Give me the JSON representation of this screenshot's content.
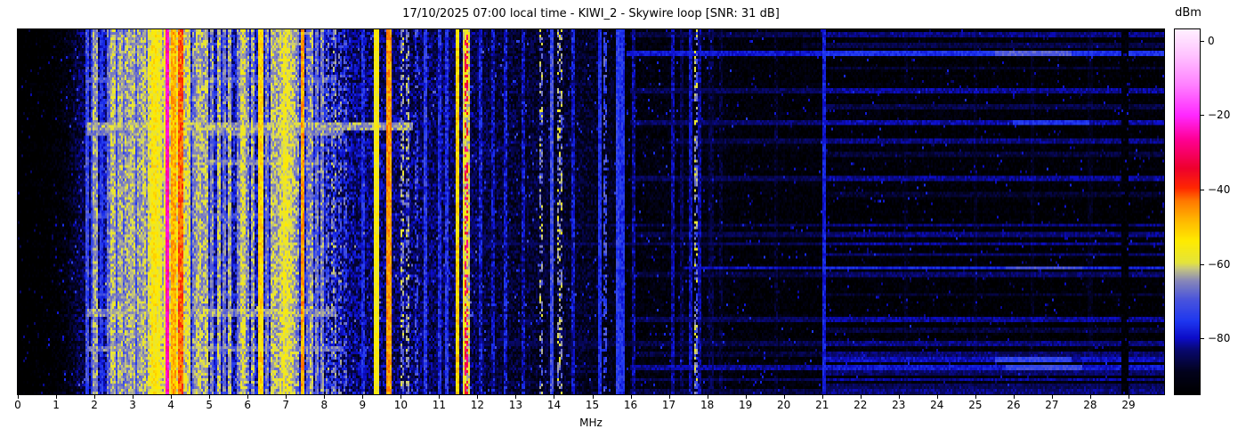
{
  "header": {
    "datetime_local": "17/10/2025 07:00",
    "station": "KIWI_2",
    "antenna": "Skywire loop",
    "snr": "31 dB"
  },
  "chart_data": {
    "type": "heatmap",
    "title": "17/10/2025 07:00 local time - KIWI_2 - Skywire loop [SNR: 31 dB]",
    "xlabel": "MHz",
    "colorbar_label": "dBm",
    "x_range": [
      0,
      29.93
    ],
    "xticks": [
      0,
      1,
      2,
      3,
      4,
      5,
      6,
      7,
      8,
      9,
      10,
      11,
      12,
      13,
      14,
      15,
      16,
      17,
      18,
      19,
      20,
      21,
      22,
      23,
      24,
      25,
      26,
      27,
      28,
      29
    ],
    "z_range": [
      -95,
      3
    ],
    "colorbar_ticks": [
      {
        "v": 0,
        "label": "0"
      },
      {
        "v": -20,
        "label": "−20"
      },
      {
        "v": -40,
        "label": "−40"
      },
      {
        "v": -60,
        "label": "−60"
      },
      {
        "v": -80,
        "label": "−80"
      }
    ],
    "colormap_stops": [
      [
        0.0,
        0,
        0,
        0
      ],
      [
        0.06,
        2,
        2,
        28
      ],
      [
        0.12,
        8,
        8,
        110
      ],
      [
        0.153,
        12,
        12,
        200
      ],
      [
        0.2,
        30,
        55,
        240
      ],
      [
        0.26,
        75,
        85,
        220
      ],
      [
        0.31,
        135,
        135,
        185
      ],
      [
        0.345,
        200,
        200,
        125
      ],
      [
        0.36,
        228,
        228,
        60
      ],
      [
        0.42,
        255,
        235,
        0
      ],
      [
        0.48,
        255,
        180,
        0
      ],
      [
        0.53,
        255,
        120,
        0
      ],
      [
        0.565,
        255,
        40,
        0
      ],
      [
        0.62,
        238,
        0,
        45
      ],
      [
        0.7,
        255,
        0,
        150
      ],
      [
        0.765,
        255,
        40,
        255
      ],
      [
        0.85,
        255,
        130,
        255
      ],
      [
        0.93,
        255,
        195,
        255
      ],
      [
        1.0,
        255,
        240,
        255
      ]
    ],
    "background_profile_mhz_dbm": [
      [
        0,
        -97
      ],
      [
        0.8,
        -96
      ],
      [
        1.3,
        -92
      ],
      [
        1.6,
        -86
      ],
      [
        2.0,
        -84
      ],
      [
        2.3,
        -80
      ],
      [
        2.6,
        -78
      ],
      [
        3.0,
        -79
      ],
      [
        3.4,
        -77
      ],
      [
        3.8,
        -76
      ],
      [
        4.3,
        -77
      ],
      [
        4.8,
        -79
      ],
      [
        5.5,
        -80
      ],
      [
        6.5,
        -79
      ],
      [
        7.3,
        -78
      ],
      [
        7.9,
        -80
      ],
      [
        8.4,
        -82
      ],
      [
        9.0,
        -84
      ],
      [
        10.0,
        -84
      ],
      [
        10.8,
        -85
      ],
      [
        11.8,
        -85
      ],
      [
        12.3,
        -87
      ],
      [
        13.0,
        -88
      ],
      [
        14.0,
        -88
      ],
      [
        15.0,
        -89
      ],
      [
        15.5,
        -90
      ],
      [
        15.9,
        -93
      ],
      [
        16.6,
        -92
      ],
      [
        18.0,
        -91.5
      ],
      [
        19.0,
        -93
      ],
      [
        21.0,
        -93.5
      ],
      [
        25.0,
        -94
      ],
      [
        29.93,
        -94.5
      ]
    ],
    "speckle_profile_mhz_db": [
      [
        0,
        3
      ],
      [
        1.5,
        5
      ],
      [
        2.3,
        7
      ],
      [
        8,
        7
      ],
      [
        9,
        6
      ],
      [
        13,
        5
      ],
      [
        16,
        4
      ],
      [
        21,
        3.5
      ],
      [
        29.93,
        3.5
      ]
    ],
    "signals_mhz_w_dbm_jit_dash": [
      [
        1.83,
        0.05,
        -72,
        6,
        0
      ],
      [
        1.95,
        0.05,
        -74,
        6,
        0
      ],
      [
        2.02,
        0.05,
        -64,
        5,
        0
      ],
      [
        2.2,
        0.05,
        -76,
        5,
        0
      ],
      [
        2.37,
        0.05,
        -68,
        6,
        0
      ],
      [
        2.49,
        0.09,
        -62,
        5,
        0
      ],
      [
        2.57,
        0.05,
        -71,
        6,
        0
      ],
      [
        2.67,
        0.09,
        -63,
        5,
        0
      ],
      [
        2.76,
        0.05,
        -68,
        6,
        0
      ],
      [
        2.84,
        0.09,
        -64,
        6,
        0
      ],
      [
        2.92,
        0.05,
        -67,
        6,
        0
      ],
      [
        3.0,
        0.09,
        -63,
        5,
        0
      ],
      [
        3.09,
        0.05,
        -70,
        6,
        0
      ],
      [
        3.2,
        0.09,
        -64,
        5,
        0
      ],
      [
        3.3,
        0.09,
        -62,
        5,
        0
      ],
      [
        3.38,
        0.05,
        -67,
        6,
        0
      ],
      [
        3.48,
        0.09,
        -59,
        5,
        0
      ],
      [
        3.56,
        0.09,
        -55,
        5,
        0
      ],
      [
        3.63,
        0.09,
        -57,
        5,
        0
      ],
      [
        3.7,
        0.09,
        -60,
        5,
        0
      ],
      [
        3.78,
        0.05,
        -62,
        5,
        0
      ],
      [
        3.85,
        0.05,
        -58,
        5,
        0
      ],
      [
        3.91,
        0.05,
        -24,
        3,
        0
      ],
      [
        3.98,
        0.05,
        -60,
        5,
        0
      ],
      [
        4.07,
        0.07,
        -48,
        5,
        0
      ],
      [
        4.17,
        0.05,
        -58,
        5,
        0
      ],
      [
        4.26,
        0.09,
        -42,
        4,
        0
      ],
      [
        4.36,
        0.05,
        -60,
        6,
        0
      ],
      [
        4.47,
        0.07,
        -60,
        5,
        0
      ],
      [
        4.6,
        0.05,
        -66,
        6,
        0
      ],
      [
        4.72,
        0.07,
        -62,
        5,
        0
      ],
      [
        4.85,
        0.05,
        -64,
        6,
        0
      ],
      [
        4.93,
        0.05,
        -62,
        5,
        0
      ],
      [
        5.05,
        0.05,
        -66,
        6,
        0
      ],
      [
        5.26,
        0.06,
        -62,
        5,
        0
      ],
      [
        5.4,
        0.05,
        -68,
        6,
        0
      ],
      [
        5.53,
        0.06,
        -63,
        5,
        0
      ],
      [
        5.75,
        0.05,
        -67,
        6,
        0
      ],
      [
        5.88,
        0.07,
        -60,
        5,
        0
      ],
      [
        6.0,
        0.05,
        -66,
        6,
        0
      ],
      [
        6.15,
        0.05,
        -64,
        6,
        0
      ],
      [
        6.35,
        0.1,
        -52,
        5,
        0
      ],
      [
        6.5,
        0.05,
        -67,
        6,
        0
      ],
      [
        6.67,
        0.07,
        -62,
        5,
        0
      ],
      [
        6.8,
        0.06,
        -63,
        5,
        0
      ],
      [
        6.9,
        0.06,
        -60,
        5,
        0
      ],
      [
        7.0,
        0.08,
        -58,
        5,
        0
      ],
      [
        7.1,
        0.06,
        -60,
        5,
        0
      ],
      [
        7.2,
        0.06,
        -62,
        5,
        0
      ],
      [
        7.3,
        0.05,
        -65,
        6,
        0
      ],
      [
        7.44,
        0.05,
        -47,
        5,
        0
      ],
      [
        7.56,
        0.05,
        -67,
        6,
        0
      ],
      [
        7.67,
        0.05,
        -64,
        6,
        0
      ],
      [
        7.8,
        0.05,
        -68,
        6,
        0
      ],
      [
        7.95,
        0.05,
        -66,
        6,
        0
      ],
      [
        8.1,
        0.05,
        -69,
        7,
        1
      ],
      [
        8.25,
        0.05,
        -67,
        7,
        1
      ],
      [
        8.4,
        0.05,
        -69,
        7,
        1
      ],
      [
        8.55,
        0.05,
        -71,
        7,
        1
      ],
      [
        9.0,
        0.05,
        -77,
        6,
        0
      ],
      [
        9.37,
        0.08,
        -56,
        4,
        0
      ],
      [
        9.7,
        0.08,
        -46,
        4,
        0
      ],
      [
        10.05,
        0.05,
        -64,
        6,
        1
      ],
      [
        10.16,
        0.05,
        -65,
        6,
        1
      ],
      [
        10.42,
        0.05,
        -73,
        6,
        1
      ],
      [
        10.65,
        0.05,
        -75,
        6,
        0
      ],
      [
        11.0,
        0.05,
        -77,
        6,
        0
      ],
      [
        11.2,
        0.05,
        -76,
        6,
        0
      ],
      [
        11.47,
        0.06,
        -52,
        5,
        0
      ],
      [
        11.66,
        0.05,
        -58,
        5,
        0
      ],
      [
        11.71,
        0.04,
        -32,
        6,
        1
      ],
      [
        11.76,
        0.05,
        -60,
        5,
        0
      ],
      [
        12.1,
        0.05,
        -79,
        6,
        0
      ],
      [
        12.4,
        0.05,
        -81,
        6,
        0
      ],
      [
        12.75,
        0.05,
        -79,
        6,
        0
      ],
      [
        13.2,
        0.05,
        -81,
        6,
        0
      ],
      [
        13.65,
        0.05,
        -66,
        8,
        1
      ],
      [
        13.95,
        0.05,
        -72,
        6,
        0
      ],
      [
        14.15,
        0.05,
        -64,
        8,
        1
      ],
      [
        14.5,
        0.05,
        -80,
        5,
        0
      ],
      [
        15.2,
        0.06,
        -76,
        4,
        0
      ],
      [
        15.35,
        0.05,
        -72,
        6,
        1
      ],
      [
        15.65,
        0.06,
        -74,
        4,
        0
      ],
      [
        15.78,
        0.05,
        -76,
        4,
        0
      ],
      [
        16.1,
        0.05,
        -82,
        5,
        0
      ],
      [
        17.1,
        0.05,
        -82,
        4,
        0
      ],
      [
        17.35,
        0.05,
        -86,
        4,
        0
      ],
      [
        17.55,
        0.05,
        -80,
        4,
        0
      ],
      [
        17.7,
        0.04,
        -66,
        9,
        1
      ],
      [
        17.78,
        0.05,
        -82,
        4,
        0
      ],
      [
        18.1,
        0.09,
        -87,
        4,
        0
      ],
      [
        18.35,
        0.05,
        -88,
        4,
        0
      ],
      [
        19.8,
        0.05,
        -89,
        4,
        0
      ],
      [
        21.05,
        0.06,
        -78,
        3,
        0
      ],
      [
        23.2,
        0.05,
        -90,
        3,
        0
      ],
      [
        25.0,
        0.05,
        -90,
        3,
        0
      ],
      [
        26.5,
        0.05,
        -90,
        3,
        0
      ],
      [
        28.0,
        0.05,
        -90,
        3,
        0
      ]
    ],
    "noise_bands_y_h_f0_f1_dbm": [
      [
        55,
        4,
        1.8,
        8.3,
        -71
      ],
      [
        107,
        6,
        1.8,
        10.3,
        -64
      ],
      [
        115,
        4,
        1.8,
        8.5,
        -67
      ],
      [
        148,
        5,
        4.8,
        8.0,
        -67
      ],
      [
        209,
        3,
        1.8,
        7.0,
        -73
      ],
      [
        297,
        3,
        2.0,
        8.0,
        -73
      ],
      [
        317,
        6,
        1.8,
        8.3,
        -66
      ],
      [
        357,
        5,
        1.8,
        8.5,
        -67
      ]
    ],
    "interference_lines_y_h_f0_dbm_spot": [
      [
        5,
        3,
        16.0,
        -83,
        0,
        0,
        0
      ],
      [
        17,
        3,
        20.5,
        -86,
        0,
        0,
        0
      ],
      [
        26,
        4,
        15.9,
        -76,
        25.5,
        27.5,
        -69
      ],
      [
        42,
        3,
        21.0,
        -88,
        0,
        0,
        0
      ],
      [
        67,
        3,
        16.0,
        -82,
        0,
        0,
        0
      ],
      [
        85,
        3,
        21.0,
        -86,
        0,
        0,
        0
      ],
      [
        103,
        3,
        16.0,
        -81,
        26.0,
        28.0,
        -76
      ],
      [
        125,
        3,
        17.0,
        -83,
        0,
        0,
        0
      ],
      [
        139,
        3,
        21.0,
        -87,
        0,
        0,
        0
      ],
      [
        167,
        3,
        16.0,
        -82,
        0,
        0,
        0
      ],
      [
        185,
        3,
        21.0,
        -88,
        0,
        0,
        0
      ],
      [
        219,
        3,
        8.5,
        -83,
        0,
        0,
        0
      ],
      [
        230,
        3,
        16.0,
        -83,
        0,
        0,
        0
      ],
      [
        240,
        3,
        9.0,
        -82,
        0,
        0,
        0
      ],
      [
        252,
        3,
        21.0,
        -84,
        0,
        0,
        0
      ],
      [
        267,
        3,
        17.4,
        -77,
        25.8,
        27.8,
        -70
      ],
      [
        274,
        3,
        16.0,
        -84,
        0,
        0,
        0
      ],
      [
        297,
        3,
        21.0,
        -88,
        0,
        0,
        0
      ],
      [
        325,
        3,
        16.0,
        -82,
        0,
        0,
        0
      ],
      [
        338,
        3,
        21.0,
        -87,
        0,
        0,
        0
      ],
      [
        352,
        3,
        12.0,
        -83,
        0,
        0,
        0
      ],
      [
        364,
        3,
        16.0,
        -84,
        0,
        0,
        0
      ],
      [
        371,
        3,
        21.0,
        -80,
        25.5,
        27.5,
        -73
      ],
      [
        379,
        3,
        16.0,
        -79,
        25.8,
        27.8,
        -72
      ],
      [
        386,
        3,
        21.0,
        -84,
        0,
        0,
        0
      ],
      [
        393,
        3,
        16.0,
        -82,
        0,
        0,
        0
      ],
      [
        400,
        3,
        21.0,
        -85,
        0,
        0,
        0
      ],
      [
        407,
        3,
        16.0,
        -83,
        0,
        0,
        0
      ]
    ],
    "interference_gap_mhz": [
      28.82,
      29.02
    ]
  }
}
